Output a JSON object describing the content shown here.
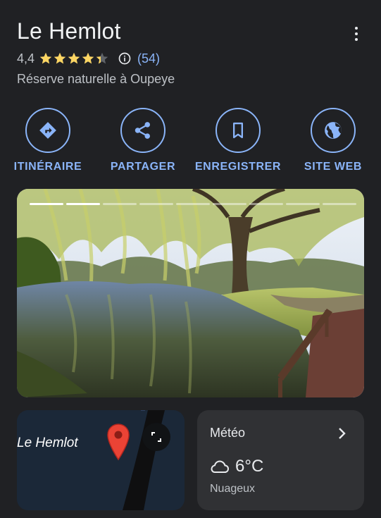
{
  "place": {
    "name": "Le Hemlot",
    "rating": "4,4",
    "rating_value": 4.4,
    "review_count": "(54)",
    "category": "Réserve naturelle à Oupeye"
  },
  "actions": [
    {
      "label": "ITINÉRAIRE",
      "icon": "directions-icon"
    },
    {
      "label": "PARTAGER",
      "icon": "share-icon"
    },
    {
      "label": "ENREGISTRER",
      "icon": "bookmark-icon"
    },
    {
      "label": "SITE WEB",
      "icon": "globe-icon"
    }
  ],
  "photo": {
    "segments": 9,
    "active_segment": 1
  },
  "map_card": {
    "label": "Le Hemlot"
  },
  "weather": {
    "title": "Météo",
    "temperature": "6°C",
    "condition": "Nuageux"
  },
  "colors": {
    "background": "#202124",
    "accent": "#8ab4f8",
    "star": "#fdd663",
    "pin": "#ea4335"
  }
}
